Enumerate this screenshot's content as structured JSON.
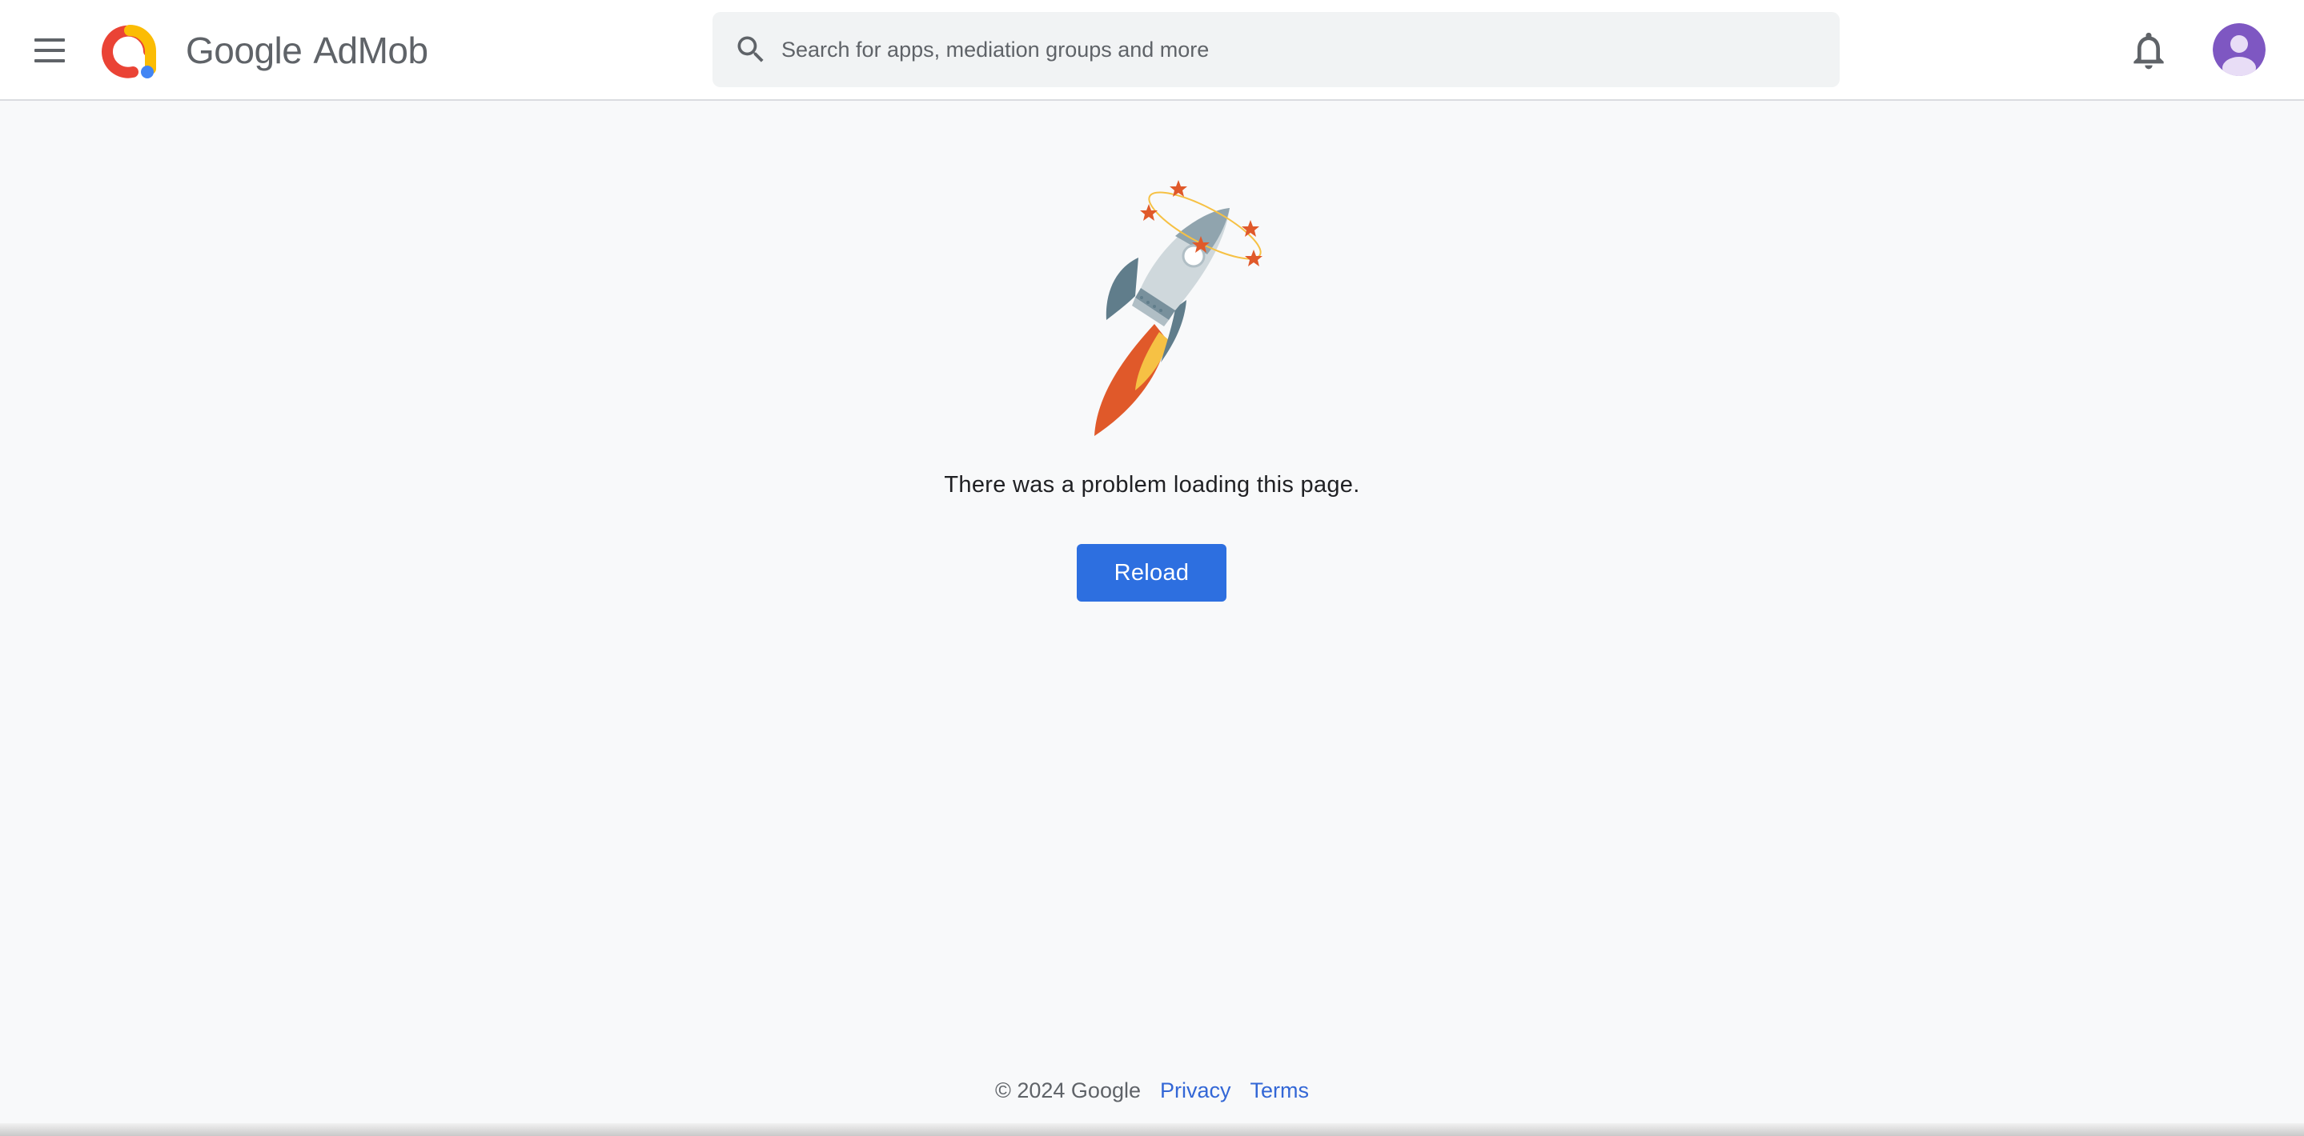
{
  "header": {
    "menu_icon": "hamburger-menu-icon",
    "brand_google": "Google",
    "brand_product": "AdMob",
    "search": {
      "placeholder": "Search for apps, mediation groups and more",
      "icon": "search-icon"
    },
    "notifications_icon": "bell-icon",
    "account_icon": "account-avatar-icon"
  },
  "main": {
    "illustration": "rocket-error-illustration",
    "message": "There was a problem loading this page.",
    "reload_label": "Reload"
  },
  "footer": {
    "copyright": "© 2024 Google",
    "privacy": "Privacy",
    "terms": "Terms"
  },
  "colors": {
    "primary_button": "#2d6fe0",
    "link": "#3367d6",
    "background": "#f8f9fa",
    "avatar": "#7e57c2"
  }
}
